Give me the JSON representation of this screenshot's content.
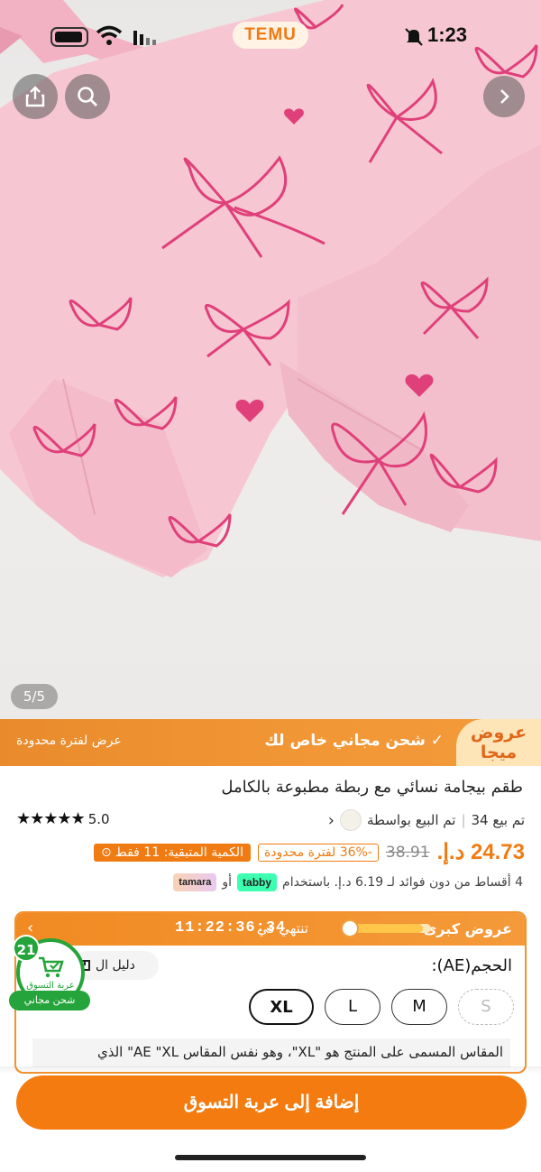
{
  "status_bar": {
    "brand_pill": "TEMU",
    "time": "1:23",
    "icons": [
      "battery-icon",
      "wifi-icon",
      "signal-icon",
      "mute-bell-icon"
    ]
  },
  "gallery": {
    "counter": "5/5",
    "buttons": [
      "share-icon",
      "search-icon",
      "chevron-right-icon"
    ]
  },
  "promo_banner": {
    "badge": "عروض ميجا",
    "free_shipping": "شحن مجاني خاص لك",
    "limited": "عرض لفترة محدودة"
  },
  "product": {
    "title": "طقم بيجامة نسائي مع ربطة مطبوعة بالكامل",
    "sold": "تم بيع 34",
    "seller": "تم البيع بواسطة",
    "rating": "5.0",
    "stars": "★★★★★",
    "price_now": "24.73 د.إ.",
    "price_old": "38.91",
    "discount": "-36% لفترة محدودة",
    "stock_left": "الكمية المتبقية: 11 فقط",
    "installments": "4 أقساط من دون فوائد لـ 6.19 د.إ. باستخدام",
    "or": "أو",
    "tabby": "tabby",
    "tamara": "tamara"
  },
  "mega_offer": {
    "title": "عروض كبرى",
    "ends_in": "تنتهي في",
    "timer": "11:22:36:34",
    "progress": 0.9
  },
  "size": {
    "label": "الحجم(AE):",
    "guide": "دليل ال",
    "options": [
      "S",
      "M",
      "L",
      "XL"
    ],
    "selected": "XL",
    "note": "المقاس المسمى على المنتج هو \"XL\"، وهو نفس المقاس AE \"XL\" الذي"
  },
  "cart": {
    "count": "21",
    "label": "عربة التسوق",
    "free_shipping": "شحن مجاني"
  },
  "cta": {
    "add_to_cart": "إضافة إلى عربة التسوق"
  },
  "colors": {
    "accent": "#f47b0f",
    "green": "#24a43a",
    "fabric": "#f6c9d4",
    "print": "#e0407a"
  }
}
